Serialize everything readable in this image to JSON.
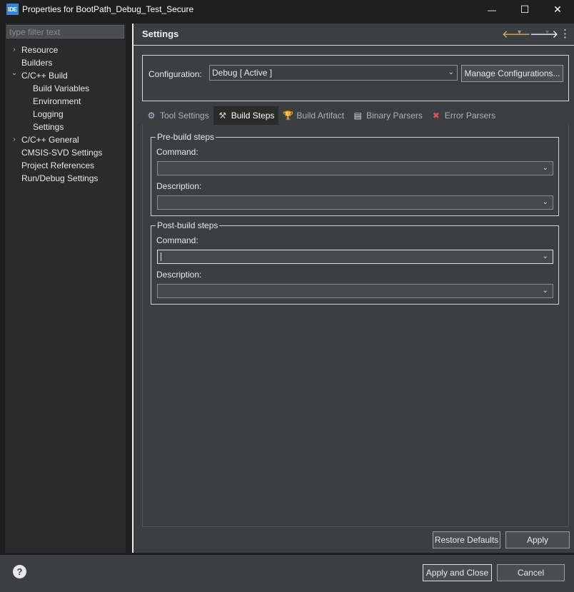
{
  "window": {
    "icon_text": "IDE",
    "title": "Properties for BootPath_Debug_Test_Secure",
    "minimize": "—",
    "maximize": "☐",
    "close": "✕"
  },
  "sidebar": {
    "filter_placeholder": "type filter text",
    "items": [
      {
        "label": "Resource",
        "expander": "›"
      },
      {
        "label": "Builders",
        "expander": ""
      },
      {
        "label": "C/C++ Build",
        "expander": "⌄"
      },
      {
        "label": "Build Variables",
        "expander": ""
      },
      {
        "label": "Environment",
        "expander": ""
      },
      {
        "label": "Logging",
        "expander": ""
      },
      {
        "label": "Settings",
        "expander": ""
      },
      {
        "label": "C/C++ General",
        "expander": "›"
      },
      {
        "label": "CMSIS-SVD Settings",
        "expander": ""
      },
      {
        "label": "Project References",
        "expander": ""
      },
      {
        "label": "Run/Debug Settings",
        "expander": ""
      }
    ]
  },
  "header": {
    "title": "Settings",
    "back_icon": "🡐",
    "forward_icon": "🡒",
    "dropdown_icon": "▾",
    "menu_icon": "⋮"
  },
  "configuration": {
    "label": "Configuration:",
    "value": "Debug  [ Active ]",
    "manage_button": "Manage Configurations..."
  },
  "tabs": [
    {
      "label": "Tool Settings",
      "icon": "⚙"
    },
    {
      "label": "Build Steps",
      "icon": "⚒"
    },
    {
      "label": "Build Artifact",
      "icon": "🏆"
    },
    {
      "label": "Binary Parsers",
      "icon": "▤"
    },
    {
      "label": "Error Parsers",
      "icon": "✖"
    }
  ],
  "pre_build": {
    "title": "Pre-build steps",
    "command_label": "Command:",
    "command_value": "",
    "description_label": "Description:",
    "description_value": ""
  },
  "post_build": {
    "title": "Post-build steps",
    "command_label": "Command:",
    "command_value": "",
    "description_label": "Description:",
    "description_value": ""
  },
  "buttons": {
    "restore_defaults": "Restore Defaults",
    "apply": "Apply",
    "apply_and_close": "Apply and Close",
    "cancel": "Cancel",
    "help": "?"
  },
  "colors": {
    "accent": "#2f86d6",
    "background": "#3c3f41",
    "sidebar": "#2b2b2b",
    "nav_back": "#e8b84a"
  }
}
